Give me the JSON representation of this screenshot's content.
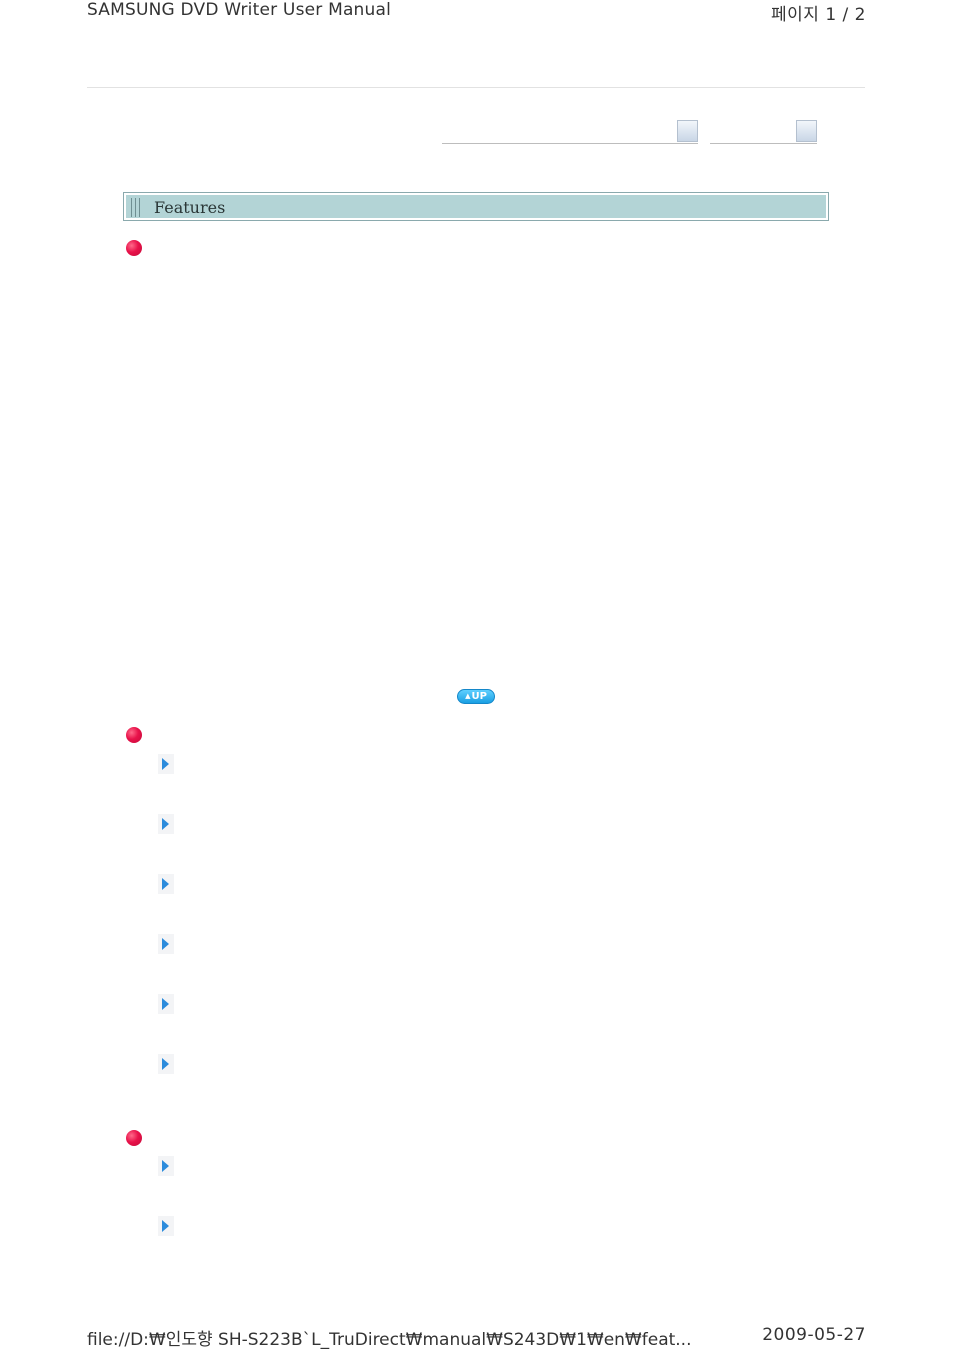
{
  "header": {
    "doc_title": "SAMSUNG DVD Writer User Manual",
    "page_indicator": "페이지 1 / 2"
  },
  "section": {
    "title": "Features"
  },
  "up_button": {
    "label": "UP"
  },
  "footer": {
    "file_path": "file://D:₩인도향 SH-S223B`L_TruDirect₩manual₩S243D₩1₩en₩feat...",
    "date": "2009-05-27"
  },
  "icons": {
    "bullet": "red-bullet-icon",
    "arrow": "blue-arrow-icon",
    "nav_button": "dropdown-button-icon"
  },
  "colors": {
    "section_bar": "#b3d4d6",
    "bullet": "#e8124a",
    "arrow": "#2b8bdc",
    "up_button": "#1a9fe3"
  }
}
